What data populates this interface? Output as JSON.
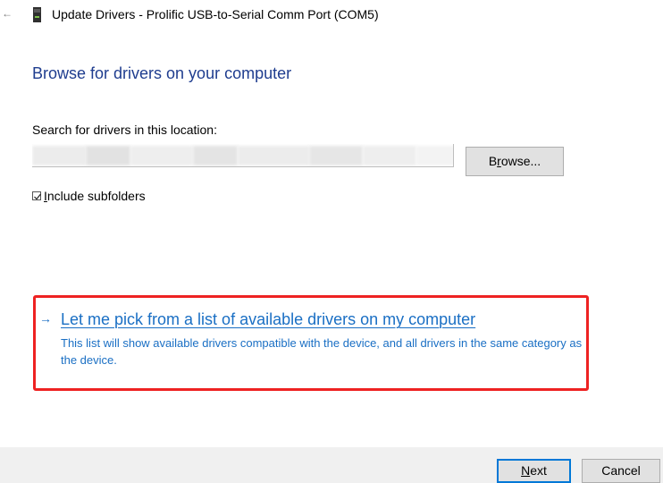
{
  "window": {
    "title": "Update Drivers - Prolific USB-to-Serial Comm Port (COM5)",
    "back_icon": "back-arrow-icon",
    "device_icon": "usb-device-icon"
  },
  "page": {
    "heading": "Browse for drivers on your computer",
    "search_label": "Search for drivers in this location:",
    "path_value": "",
    "browse_label_prefix": "B",
    "browse_label_accel": "r",
    "browse_label_suffix": "owse...",
    "include_subfolders": {
      "checked": true,
      "label_accel": "I",
      "label_rest": "nclude subfolders"
    }
  },
  "pick_option": {
    "arrow": "→",
    "title": "Let me pick from a list of available drivers on my computer",
    "description": "This list will show available drivers compatible with the device, and all drivers in the same category as the device."
  },
  "footer": {
    "next_accel": "N",
    "next_rest": "ext",
    "cancel_label": "Cancel"
  },
  "colors": {
    "heading": "#1f3d8f",
    "link": "#1a6fc4",
    "highlight": "#ee2222",
    "footer_bg": "#f0f0f0",
    "button_bg": "#e1e1e1",
    "focus_border": "#0078d7"
  }
}
